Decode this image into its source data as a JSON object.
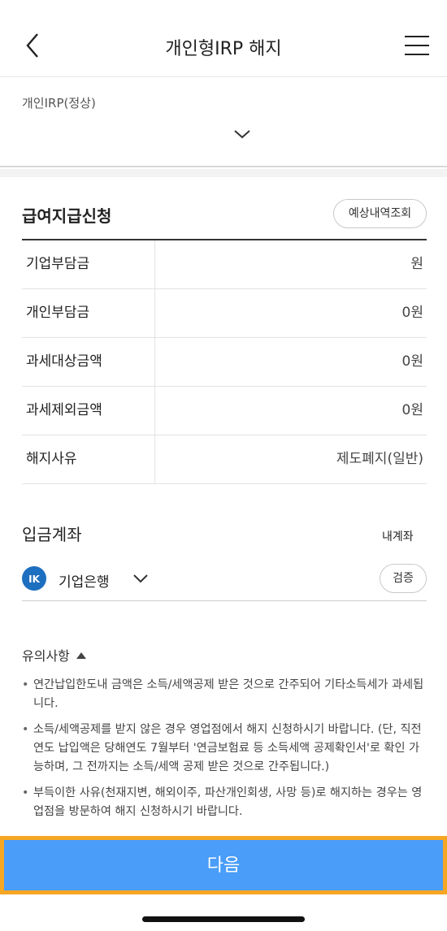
{
  "header": {
    "title": "개인형IRP 해지"
  },
  "account_selector": {
    "label": "개인IRP(정상)"
  },
  "benefit": {
    "title": "급여지급신청",
    "estimate_button": "예상내역조회",
    "rows": [
      {
        "label": "기업부담금",
        "value": "원"
      },
      {
        "label": "개인부담금",
        "value": "0원"
      },
      {
        "label": "과세대상금액",
        "value": "0원"
      },
      {
        "label": "과세제외금액",
        "value": "0원"
      },
      {
        "label": "해지사유",
        "value": "제도폐지(일반)"
      }
    ]
  },
  "deposit": {
    "title": "입금계좌",
    "my_account_link": "내계좌",
    "bank_name": "기업은행",
    "verify_button": "검증"
  },
  "notice": {
    "title": "유의사항",
    "items": [
      "연간납입한도내 금액은 소득/세액공제 받은 것으로 간주되어 기타소득세가 과세됩니다.",
      "소득/세액공제를 받지 않은 경우 영업점에서 해지 신청하시기 바랍니다. (단, 직전연도 납입액은 당해연도 7월부터 '연금보험료 등 소득세액 공제확인서'로 확인 가능하며, 그 전까지는 소득/세액 공제 받은 것으로 간주됩니다.)",
      "부득이한 사유(천재지변, 해외이주, 파산개인회생, 사망 등)로 해지하는 경우는 영업점을 방문하여 해지 신청하시기 바랍니다."
    ]
  },
  "footer": {
    "next_button": "다음"
  },
  "colors": {
    "primary": "#4a9df8",
    "highlight": "#f5a623",
    "bank_logo": "#1d6fbf"
  },
  "icons": [
    "back-arrow-icon",
    "hamburger-menu-icon",
    "chevron-down-icon",
    "ibk-bank-logo-icon",
    "triangle-up-icon"
  ]
}
